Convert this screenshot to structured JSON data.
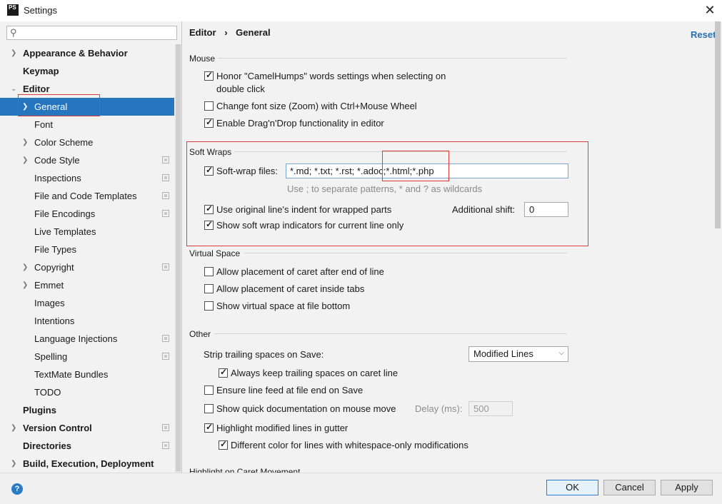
{
  "window": {
    "title": "Settings",
    "logo": "PS"
  },
  "search": {
    "placeholder": ""
  },
  "sidebar": {
    "items": [
      {
        "label": "Appearance & Behavior"
      },
      {
        "label": "Keymap"
      },
      {
        "label": "Editor"
      },
      {
        "label": "General"
      },
      {
        "label": "Font"
      },
      {
        "label": "Color Scheme"
      },
      {
        "label": "Code Style"
      },
      {
        "label": "Inspections"
      },
      {
        "label": "File and Code Templates"
      },
      {
        "label": "File Encodings"
      },
      {
        "label": "Live Templates"
      },
      {
        "label": "File Types"
      },
      {
        "label": "Copyright"
      },
      {
        "label": "Emmet"
      },
      {
        "label": "Images"
      },
      {
        "label": "Intentions"
      },
      {
        "label": "Language Injections"
      },
      {
        "label": "Spelling"
      },
      {
        "label": "TextMate Bundles"
      },
      {
        "label": "TODO"
      },
      {
        "label": "Plugins"
      },
      {
        "label": "Version Control"
      },
      {
        "label": "Directories"
      },
      {
        "label": "Build, Execution, Deployment"
      }
    ]
  },
  "header": {
    "crumb_parent": "Editor",
    "crumb_sep": "›",
    "crumb_current": "General",
    "reset_label": "Reset"
  },
  "mouse": {
    "title": "Mouse",
    "camelhumps_line1": "Honor \"CamelHumps\" words settings when selecting on",
    "camelhumps_line2": "double click",
    "zoom": "Change font size (Zoom) with Ctrl+Mouse Wheel",
    "dragdrop": "Enable Drag'n'Drop functionality in editor"
  },
  "soft_wraps": {
    "title": "Soft Wraps",
    "files_label": "Soft-wrap files:",
    "files_value": "*.md; *.txt; *.rst; *.adoc;*.html;*.php",
    "hint": "Use ; to separate patterns, * and ? as wildcards",
    "indent_label": "Use original line's indent for wrapped parts",
    "shift_label": "Additional shift:",
    "shift_value": "0",
    "indicators_label": "Show soft wrap indicators for current line only"
  },
  "virtual_space": {
    "title": "Virtual Space",
    "after_end": "Allow placement of caret after end of line",
    "inside_tabs": "Allow placement of caret inside tabs",
    "file_bottom": "Show virtual space at file bottom"
  },
  "other": {
    "title": "Other",
    "strip_label": "Strip trailing spaces on Save:",
    "strip_value": "Modified Lines",
    "keep_trailing": "Always keep trailing spaces on caret line",
    "line_feed": "Ensure line feed at file end on Save",
    "quick_doc": "Show quick documentation on mouse move",
    "delay_label": "Delay (ms):",
    "delay_value": "500",
    "highlight_modified": "Highlight modified lines in gutter",
    "whitespace_color": "Different color for lines with whitespace-only modifications"
  },
  "next_section": {
    "title": "Highlight on Caret Movement"
  },
  "buttons": {
    "ok": "OK",
    "cancel": "Cancel",
    "apply": "Apply",
    "help": "?"
  },
  "colors": {
    "selection": "#2675bf",
    "link": "#2470b3",
    "annotation": "#e03a3a"
  }
}
